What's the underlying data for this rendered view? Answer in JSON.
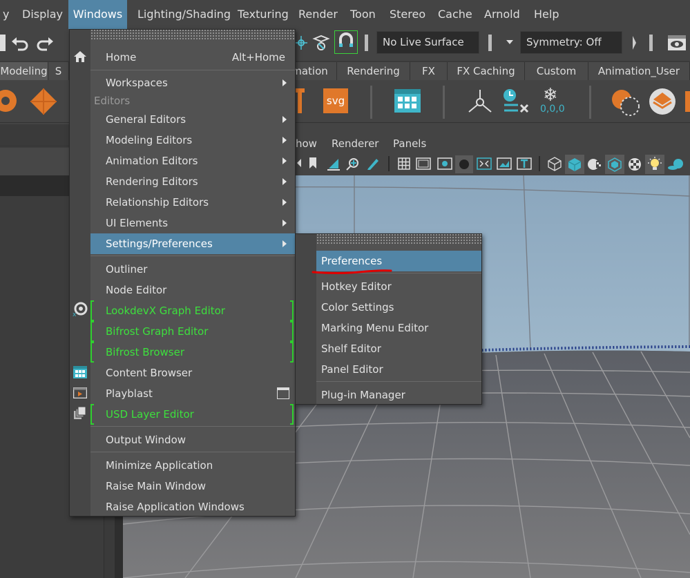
{
  "menubar": {
    "items": [
      "y",
      "Display",
      "Windows",
      "Lighting/Shading",
      "Texturing",
      "Render",
      "Toon",
      "Stereo",
      "Cache",
      "Arnold",
      "Help"
    ],
    "active": "Windows"
  },
  "status": {
    "live_surface": "No Live Surface",
    "symmetry": "Symmetry: Off"
  },
  "shelf_tabs": [
    "Modeling",
    "S",
    "mation",
    "Rendering",
    "FX",
    "FX Caching",
    "Custom",
    "Animation_User"
  ],
  "shelf": {
    "svg_label": "svg",
    "coords_label": "0,0,0"
  },
  "viewport_menu": [
    "how",
    "Renderer",
    "Panels"
  ],
  "windows_menu": {
    "home": "Home",
    "home_shortcut": "Alt+Home",
    "workspaces": "Workspaces",
    "editors_header": "Editors",
    "general_editors": "General Editors",
    "modeling_editors": "Modeling Editors",
    "animation_editors": "Animation Editors",
    "rendering_editors": "Rendering Editors",
    "relationship_editors": "Relationship Editors",
    "ui_elements": "UI Elements",
    "settings_preferences": "Settings/Preferences",
    "outliner": "Outliner",
    "node_editor": "Node Editor",
    "lookdevx": "LookdevX Graph Editor",
    "bifrost_graph": "Bifrost Graph Editor",
    "bifrost_browser": "Bifrost Browser",
    "content_browser": "Content Browser",
    "playblast": "Playblast",
    "usd_layer_editor": "USD Layer Editor",
    "output_window": "Output Window",
    "minimize_app": "Minimize Application",
    "raise_main": "Raise Main Window",
    "raise_app_windows": "Raise Application Windows"
  },
  "settings_submenu": {
    "preferences": "Preferences",
    "hotkey_editor": "Hotkey Editor",
    "color_settings": "Color Settings",
    "marking_menu_editor": "Marking Menu Editor",
    "shelf_editor": "Shelf Editor",
    "panel_editor": "Panel Editor",
    "plugin_manager": "Plug-in Manager"
  },
  "colors": {
    "highlight": "#5285a6",
    "green_plugin": "#3de03d",
    "annotation": "#e00000"
  }
}
